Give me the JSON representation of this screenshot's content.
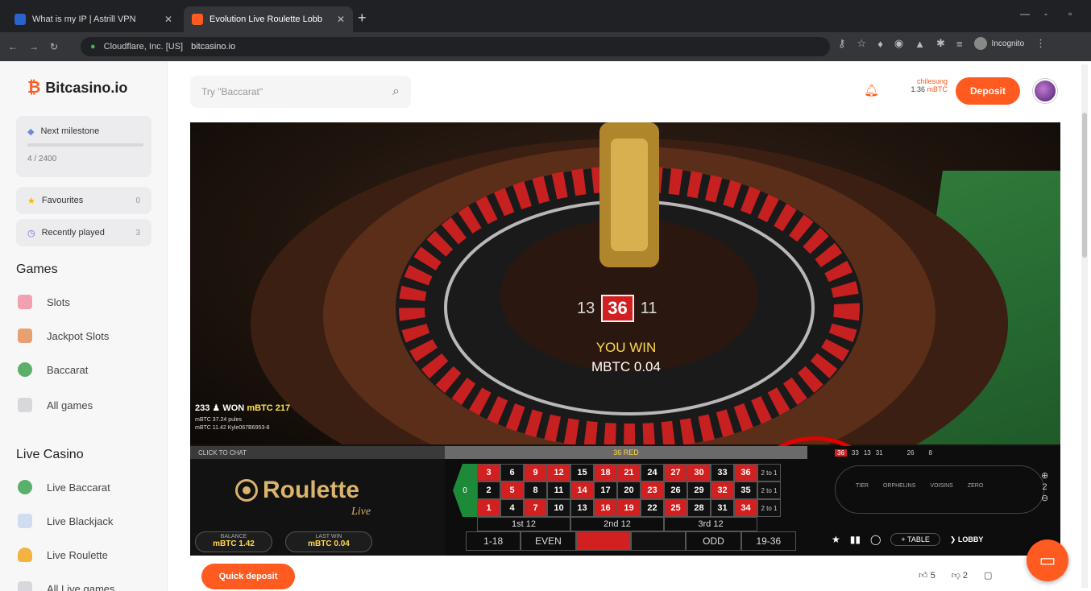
{
  "browser": {
    "tabs": [
      {
        "title": "What is my IP | Astrill VPN"
      },
      {
        "title": "Evolution Live Roulette Lobb"
      }
    ],
    "new_tab": "+",
    "site_identity": "Cloudflare, Inc. [US]",
    "url": "bitcasino.io",
    "incognito_label": "Incognito"
  },
  "sidebar": {
    "logo": "Bitcasino.io",
    "milestone": {
      "label": "Next milestone",
      "value": "4 / 2400"
    },
    "favourites": {
      "label": "Favourites",
      "count": "0"
    },
    "recently_played": {
      "label": "Recently played",
      "count": "3"
    },
    "games_title": "Games",
    "games": [
      {
        "label": "Slots"
      },
      {
        "label": "Jackpot Slots"
      },
      {
        "label": "Baccarat"
      },
      {
        "label": "All games"
      }
    ],
    "live_title": "Live Casino",
    "live": [
      {
        "label": "Live Baccarat"
      },
      {
        "label": "Live Blackjack"
      },
      {
        "label": "Live Roulette"
      },
      {
        "label": "All Live games"
      }
    ]
  },
  "header": {
    "search_placeholder": "Try \"Baccarat\"",
    "username": "chilesung",
    "balance": "1.36",
    "balance_unit": "mBTC",
    "deposit": "Deposit"
  },
  "game": {
    "numbers_left": "13",
    "numbers_mid": "36",
    "numbers_right": "11",
    "win_line1": "YOU WIN",
    "win_line2": "MBTC 0.04",
    "winners_count": "233",
    "winners_label": "WON",
    "winners_amount": "mBTC 217",
    "winner1": "mBTC 37.24 pules",
    "winner2": "mBTC 11.42 Kyle067B6953-8",
    "chat": "CLICK TO CHAT",
    "result": "36 RED",
    "brand": "Roulette",
    "brand_sub": "Live",
    "balance_label": "BALANCE",
    "balance_value": "mBTC 1.42",
    "lastwin_label": "LAST WIN",
    "lastwin_value": "mBTC 0.04",
    "zero": "0",
    "rows": [
      [
        {
          "n": "3",
          "c": "red"
        },
        {
          "n": "6",
          "c": "black"
        },
        {
          "n": "9",
          "c": "red"
        },
        {
          "n": "12",
          "c": "red"
        },
        {
          "n": "15",
          "c": "black"
        },
        {
          "n": "18",
          "c": "red"
        },
        {
          "n": "21",
          "c": "red"
        },
        {
          "n": "24",
          "c": "black"
        },
        {
          "n": "27",
          "c": "red"
        },
        {
          "n": "30",
          "c": "red"
        },
        {
          "n": "33",
          "c": "black"
        },
        {
          "n": "36",
          "c": "red"
        },
        {
          "n": "2 to 1",
          "c": "col"
        }
      ],
      [
        {
          "n": "2",
          "c": "black"
        },
        {
          "n": "5",
          "c": "red"
        },
        {
          "n": "8",
          "c": "black"
        },
        {
          "n": "11",
          "c": "black"
        },
        {
          "n": "14",
          "c": "red"
        },
        {
          "n": "17",
          "c": "black"
        },
        {
          "n": "20",
          "c": "black"
        },
        {
          "n": "23",
          "c": "red"
        },
        {
          "n": "26",
          "c": "black"
        },
        {
          "n": "29",
          "c": "black"
        },
        {
          "n": "32",
          "c": "red"
        },
        {
          "n": "35",
          "c": "black"
        },
        {
          "n": "2 to 1",
          "c": "col"
        }
      ],
      [
        {
          "n": "1",
          "c": "red"
        },
        {
          "n": "4",
          "c": "black"
        },
        {
          "n": "7",
          "c": "red"
        },
        {
          "n": "10",
          "c": "black"
        },
        {
          "n": "13",
          "c": "black"
        },
        {
          "n": "16",
          "c": "red"
        },
        {
          "n": "19",
          "c": "red"
        },
        {
          "n": "22",
          "c": "black"
        },
        {
          "n": "25",
          "c": "red"
        },
        {
          "n": "28",
          "c": "black"
        },
        {
          "n": "31",
          "c": "black"
        },
        {
          "n": "34",
          "c": "red"
        },
        {
          "n": "2 to 1",
          "c": "col"
        }
      ]
    ],
    "dozens": [
      "1st 12",
      "2nd 12",
      "3rd 12"
    ],
    "outside": [
      "1-18",
      "EVEN",
      "",
      "",
      "ODD",
      "19-36"
    ],
    "history": [
      "36",
      "33",
      "13",
      "31",
      "",
      "",
      "",
      "",
      "26",
      "",
      "",
      "8",
      "",
      "",
      ""
    ],
    "race_labels": [
      "TIER",
      "ORPHELINS",
      "VOISINS",
      "ZERO"
    ],
    "limit_value": "2",
    "table_btn": "TABLE",
    "lobby_btn": "LOBBY"
  },
  "footer": {
    "quick_deposit": "Quick deposit",
    "likes": "5",
    "dislikes": "2"
  },
  "colors": {
    "accent": "#ff5a1f",
    "red": "#d21f1f",
    "green": "#1d8a3a",
    "gold": "#d9b46a"
  }
}
